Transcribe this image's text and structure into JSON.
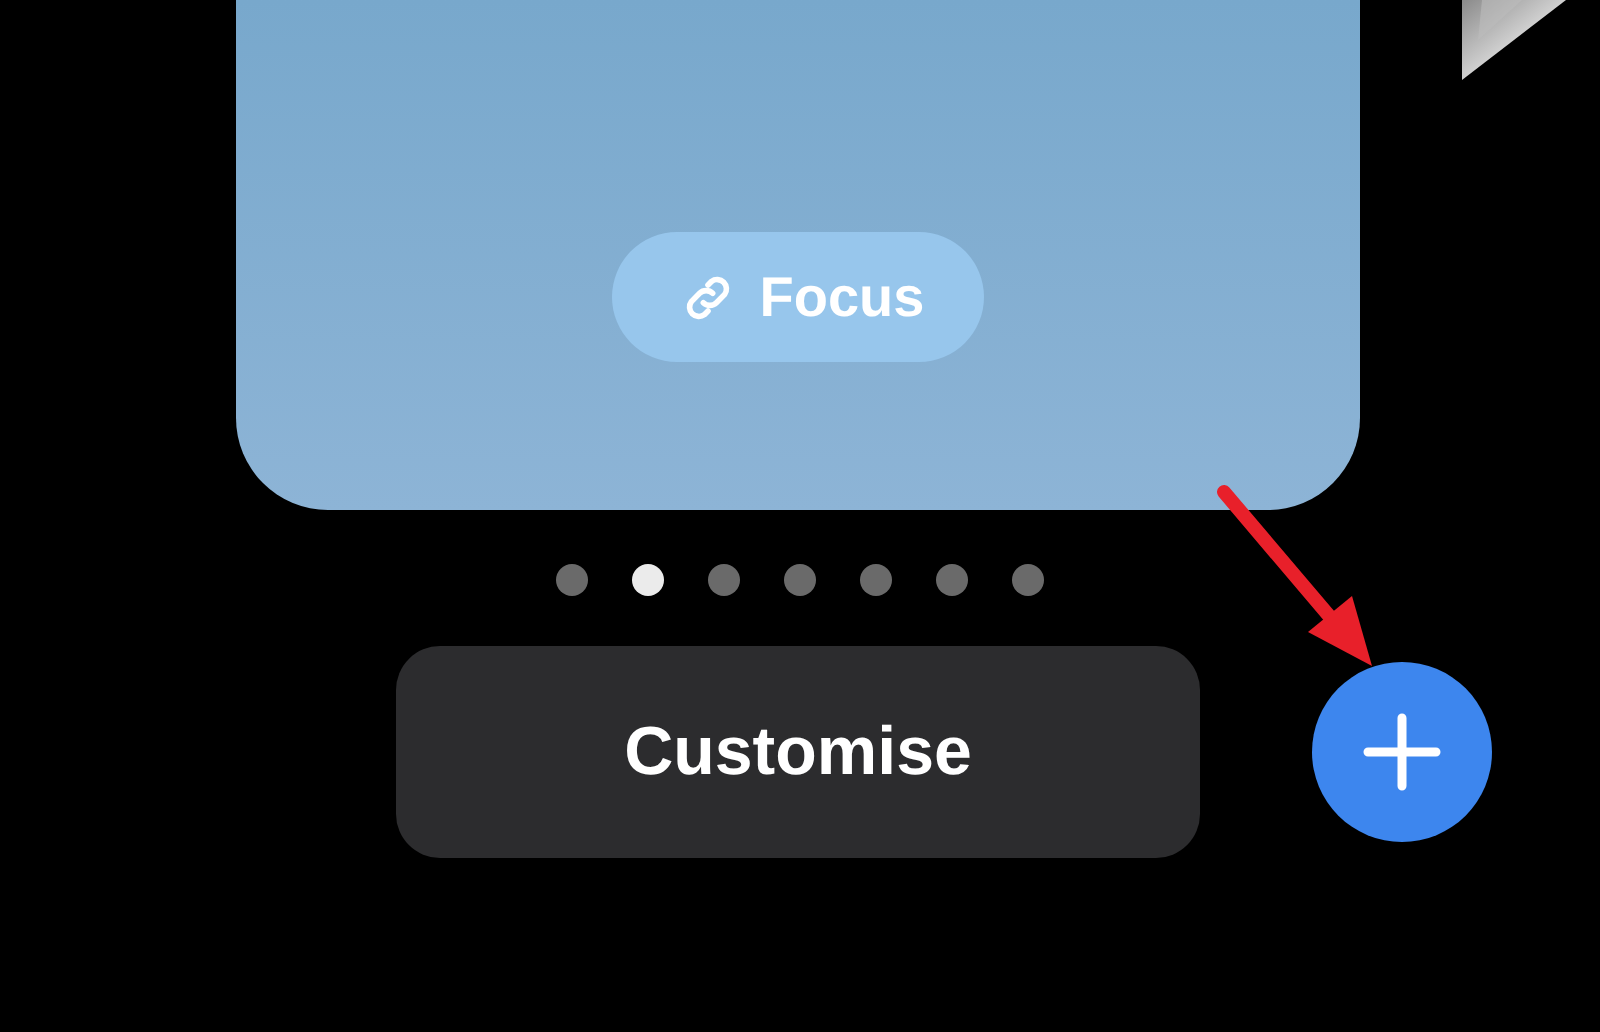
{
  "wallpaper_card": {
    "focus_button": {
      "label": "Focus"
    }
  },
  "page_dots": [
    {
      "selected": false
    },
    {
      "selected": true
    },
    {
      "selected": false
    },
    {
      "selected": false
    },
    {
      "selected": false
    },
    {
      "selected": false
    },
    {
      "selected": false
    }
  ],
  "customise_button": {
    "label": "Customise"
  }
}
